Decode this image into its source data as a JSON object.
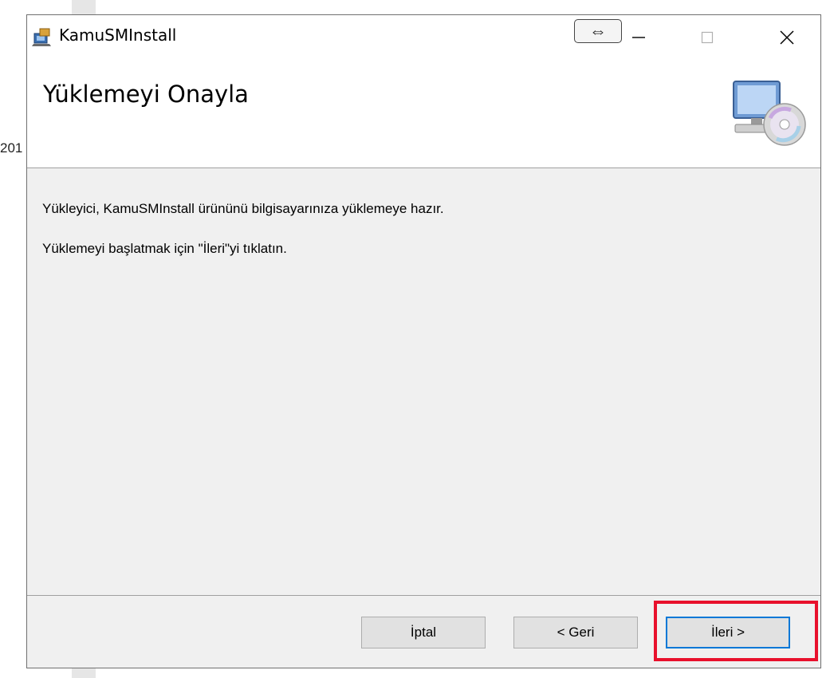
{
  "background": {
    "partial_text": "201"
  },
  "window": {
    "title": "KamuSMInstall",
    "controls": {
      "snap": "⇔",
      "minimize": "—",
      "maximize": "☐",
      "close": "✕"
    }
  },
  "header": {
    "title": "Yüklemeyi Onayla"
  },
  "content": {
    "line1": "Yükleyici, KamuSMInstall ürününü bilgisayarınıza yüklemeye hazır.",
    "line2": "Yüklemeyi başlatmak için \"İleri\"yi tıklatın."
  },
  "buttons": {
    "cancel": "İptal",
    "back": "< Geri",
    "next": "İleri >"
  },
  "colors": {
    "highlight": "#e8102c",
    "focus_border": "#0078d7"
  }
}
